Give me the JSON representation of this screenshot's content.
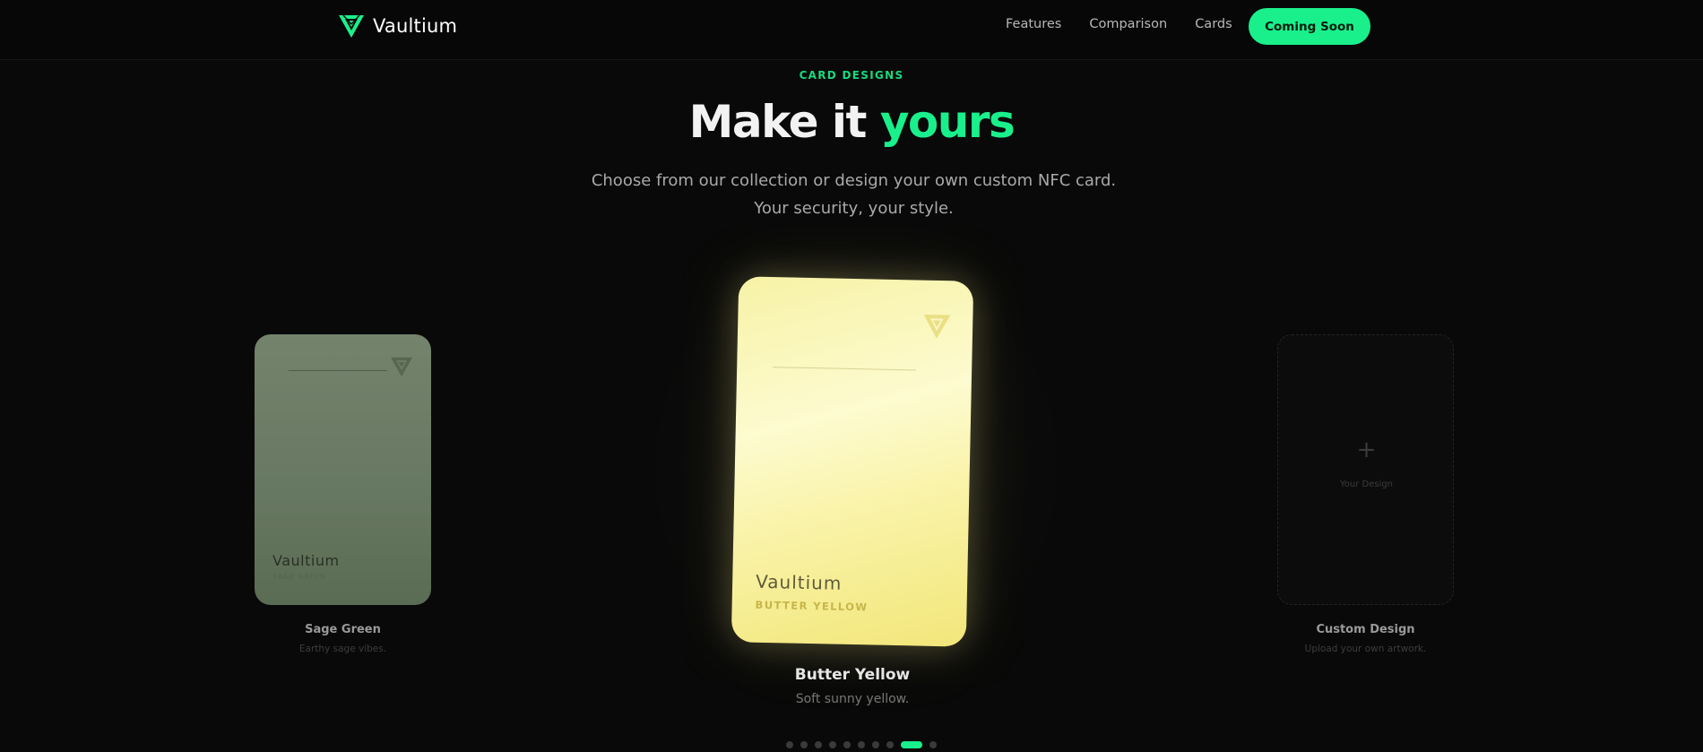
{
  "header": {
    "brand": "Vaultium",
    "nav": [
      {
        "label": "Features"
      },
      {
        "label": "Comparison"
      },
      {
        "label": "Cards"
      }
    ],
    "cta_label": "Coming Soon"
  },
  "section": {
    "eyebrow": "CARD DESIGNS",
    "title_part1": "Make it ",
    "title_part2": "yours",
    "subtitle": "Choose from our collection or design your own custom NFC card. Your security, your style."
  },
  "carousel": {
    "cards": [
      {
        "name": "Sage Green",
        "description": "Earthy sage vibes.",
        "card_brand": "Vaultium",
        "card_label": "SAGE GREEN",
        "color": "#6e7f68"
      },
      {
        "name": "Butter Yellow",
        "description": "Soft sunny yellow.",
        "card_brand": "Vaultium",
        "card_label": "BUTTER YELLOW",
        "color": "#f9f3a8"
      },
      {
        "name": "Custom Design",
        "description": "Upload your own artwork.",
        "placeholder_label": "Your Design",
        "plus_icon": "+"
      }
    ],
    "dot_count": 10,
    "active_dot_index": 8
  },
  "colors": {
    "accent": "#19f08c",
    "background": "#090909"
  },
  "icons": {
    "logo": "vaultium-logo-icon",
    "card_mark": "vaultium-mark-icon",
    "add": "plus-icon"
  }
}
